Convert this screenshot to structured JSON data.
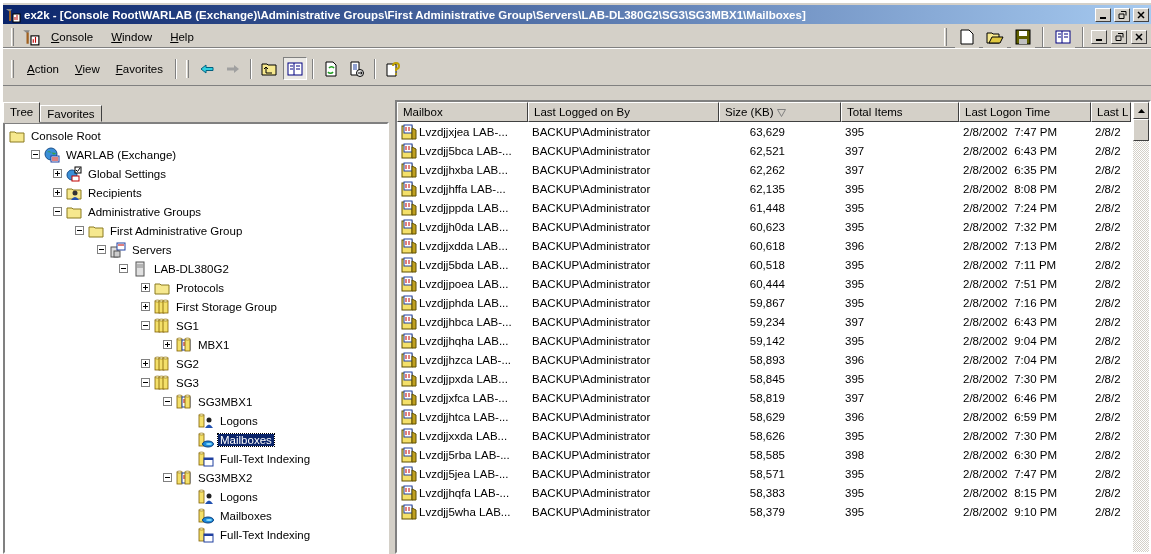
{
  "window": {
    "title": "ex2k - [Console Root\\WARLAB (Exchange)\\Administrative Groups\\First Administrative Group\\Servers\\LAB-DL380G2\\SG3\\SG3MBX1\\Mailboxes]"
  },
  "menu": [
    "Console",
    "Window",
    "Help"
  ],
  "toolbar": {
    "menus": [
      "Action",
      "View",
      "Favorites"
    ],
    "buttons": [
      {
        "kind": "back",
        "pressed": false
      },
      {
        "kind": "forward",
        "pressed": false
      },
      {
        "kind": "sep"
      },
      {
        "kind": "up",
        "pressed": false
      },
      {
        "kind": "tree",
        "pressed": true
      },
      {
        "kind": "sep"
      },
      {
        "kind": "refresh",
        "pressed": false
      },
      {
        "kind": "export",
        "pressed": false
      },
      {
        "kind": "sep"
      },
      {
        "kind": "help",
        "pressed": false
      }
    ]
  },
  "tabs": [
    {
      "label": "Tree",
      "selected": true
    },
    {
      "label": "Favorites",
      "selected": false
    }
  ],
  "tree": [
    {
      "label": "Console Root",
      "kind": "folder",
      "selected": false,
      "children": [
        {
          "label": "WARLAB (Exchange)",
          "kind": "org",
          "expanded": true,
          "selected": false,
          "children": [
            {
              "label": "Global Settings",
              "kind": "settings",
              "expanded": false,
              "selected": false
            },
            {
              "label": "Recipients",
              "kind": "recipients",
              "expanded": false,
              "selected": false
            },
            {
              "label": "Administrative Groups",
              "kind": "folder",
              "expanded": true,
              "selected": false,
              "children": [
                {
                  "label": "First Administrative Group",
                  "kind": "folder",
                  "expanded": true,
                  "selected": false,
                  "children": [
                    {
                      "label": "Servers",
                      "kind": "servers",
                      "expanded": true,
                      "selected": false,
                      "children": [
                        {
                          "label": "LAB-DL380G2",
                          "kind": "server",
                          "expanded": true,
                          "selected": false,
                          "children": [
                            {
                              "label": "Protocols",
                              "kind": "folder",
                              "expanded": false,
                              "selected": false
                            },
                            {
                              "label": "First Storage Group",
                              "kind": "storage",
                              "expanded": false,
                              "selected": false
                            },
                            {
                              "label": "SG1",
                              "kind": "storage",
                              "expanded": true,
                              "selected": false,
                              "children": [
                                {
                                  "label": "MBX1",
                                  "kind": "store",
                                  "expanded": false,
                                  "selected": false
                                }
                              ]
                            },
                            {
                              "label": "SG2",
                              "kind": "storage",
                              "expanded": false,
                              "selected": false
                            },
                            {
                              "label": "SG3",
                              "kind": "storage",
                              "expanded": true,
                              "selected": false,
                              "children": [
                                {
                                  "label": "SG3MBX1",
                                  "kind": "store",
                                  "expanded": true,
                                  "selected": false,
                                  "children": [
                                    {
                                      "label": "Logons",
                                      "kind": "logons",
                                      "selected": false
                                    },
                                    {
                                      "label": "Mailboxes",
                                      "kind": "mailboxes",
                                      "selected": true
                                    },
                                    {
                                      "label": "Full-Text Indexing",
                                      "kind": "fulltext",
                                      "selected": false
                                    }
                                  ]
                                },
                                {
                                  "label": "SG3MBX2",
                                  "kind": "store",
                                  "expanded": true,
                                  "selected": false,
                                  "children": [
                                    {
                                      "label": "Logons",
                                      "kind": "logons",
                                      "selected": false
                                    },
                                    {
                                      "label": "Mailboxes",
                                      "kind": "mailboxes",
                                      "selected": false
                                    },
                                    {
                                      "label": "Full-Text Indexing",
                                      "kind": "fulltext",
                                      "selected": false
                                    }
                                  ]
                                }
                              ]
                            }
                          ]
                        }
                      ]
                    }
                  ]
                }
              ]
            }
          ]
        }
      ]
    }
  ],
  "table": {
    "columns": [
      {
        "label": "Mailbox",
        "sorted": false
      },
      {
        "label": "Last Logged on By",
        "sorted": false
      },
      {
        "label": "Size (KB)",
        "sorted": true
      },
      {
        "label": "Total Items",
        "sorted": false
      },
      {
        "label": "Last Logon Time",
        "sorted": false
      },
      {
        "label": "Last L",
        "sorted": false
      }
    ],
    "rows": [
      [
        "Lvzdjjxjea LAB-...",
        "BACKUP\\Administrator",
        "63,629",
        "395",
        "2/8/2002  7:47 PM",
        "2/8/2"
      ],
      [
        "Lvzdjj5bca LAB-...",
        "BACKUP\\Administrator",
        "62,521",
        "397",
        "2/8/2002  6:43 PM",
        "2/8/2"
      ],
      [
        "Lvzdjjhxba LAB...",
        "BACKUP\\Administrator",
        "62,262",
        "397",
        "2/8/2002  6:35 PM",
        "2/8/2"
      ],
      [
        "Lvzdjjhffa LAB-...",
        "BACKUP\\Administrator",
        "62,135",
        "395",
        "2/8/2002  8:08 PM",
        "2/8/2"
      ],
      [
        "Lvzdjjppda LAB...",
        "BACKUP\\Administrator",
        "61,448",
        "395",
        "2/8/2002  7:24 PM",
        "2/8/2"
      ],
      [
        "Lvzdjjh0da LAB...",
        "BACKUP\\Administrator",
        "60,623",
        "395",
        "2/8/2002  7:32 PM",
        "2/8/2"
      ],
      [
        "Lvzdjjxdda LAB...",
        "BACKUP\\Administrator",
        "60,618",
        "396",
        "2/8/2002  7:13 PM",
        "2/8/2"
      ],
      [
        "Lvzdjj5bda LAB...",
        "BACKUP\\Administrator",
        "60,518",
        "395",
        "2/8/2002  7:11 PM",
        "2/8/2"
      ],
      [
        "Lvzdjjpoea LAB...",
        "BACKUP\\Administrator",
        "60,444",
        "395",
        "2/8/2002  7:51 PM",
        "2/8/2"
      ],
      [
        "Lvzdjjphda LAB...",
        "BACKUP\\Administrator",
        "59,867",
        "395",
        "2/8/2002  7:16 PM",
        "2/8/2"
      ],
      [
        "Lvzdjjhbca LAB-...",
        "BACKUP\\Administrator",
        "59,234",
        "397",
        "2/8/2002  6:43 PM",
        "2/8/2"
      ],
      [
        "Lvzdjjhqha LAB...",
        "BACKUP\\Administrator",
        "59,142",
        "395",
        "2/8/2002  9:04 PM",
        "2/8/2"
      ],
      [
        "Lvzdjjhzca LAB-...",
        "BACKUP\\Administrator",
        "58,893",
        "396",
        "2/8/2002  7:04 PM",
        "2/8/2"
      ],
      [
        "Lvzdjjpxda LAB...",
        "BACKUP\\Administrator",
        "58,845",
        "395",
        "2/8/2002  7:30 PM",
        "2/8/2"
      ],
      [
        "Lvzdjjxfca LAB-...",
        "BACKUP\\Administrator",
        "58,819",
        "397",
        "2/8/2002  6:46 PM",
        "2/8/2"
      ],
      [
        "Lvzdjjhtca LAB-...",
        "BACKUP\\Administrator",
        "58,629",
        "396",
        "2/8/2002  6:59 PM",
        "2/8/2"
      ],
      [
        "Lvzdjjxxda LAB...",
        "BACKUP\\Administrator",
        "58,626",
        "395",
        "2/8/2002  7:30 PM",
        "2/8/2"
      ],
      [
        "Lvzdjj5rba LAB-...",
        "BACKUP\\Administrator",
        "58,585",
        "398",
        "2/8/2002  6:30 PM",
        "2/8/2"
      ],
      [
        "Lvzdjj5jea LAB-...",
        "BACKUP\\Administrator",
        "58,571",
        "395",
        "2/8/2002  7:47 PM",
        "2/8/2"
      ],
      [
        "Lvzdjjhqfa LAB-...",
        "BACKUP\\Administrator",
        "58,383",
        "395",
        "2/8/2002  8:15 PM",
        "2/8/2"
      ],
      [
        "Lvzdjj5wha LAB...",
        "BACKUP\\Administrator",
        "58,379",
        "395",
        "2/8/2002  9:10 PM",
        "2/8/2"
      ]
    ]
  }
}
